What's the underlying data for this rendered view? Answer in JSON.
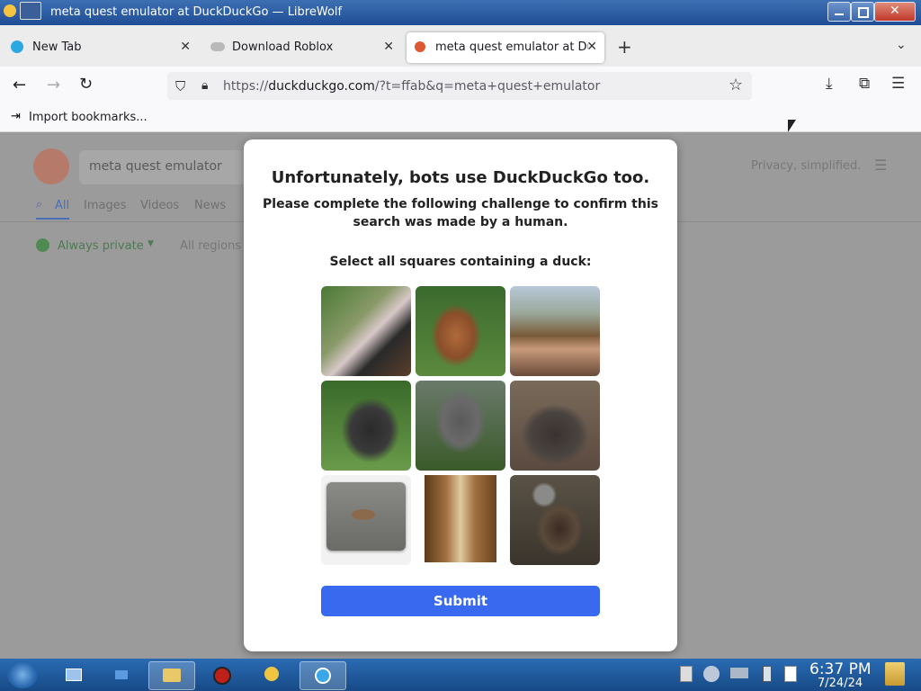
{
  "window": {
    "title": "meta quest emulator at DuckDuckGo — LibreWolf"
  },
  "tabs": [
    {
      "label": "New Tab",
      "icon": "librewolf-icon"
    },
    {
      "label": "Download Roblox",
      "icon": "cloud-icon"
    },
    {
      "label": "meta quest emulator at Du",
      "icon": "duckduckgo-icon",
      "active": true
    }
  ],
  "navbar": {
    "url_prefix": "https://",
    "url_domain": "duckduckgo.com",
    "url_path": "/?t=ffab&q=meta+quest+emulator"
  },
  "bookmarks": {
    "import_label": "Import bookmarks..."
  },
  "ddg": {
    "search_value": "meta quest emulator",
    "privacy_label": "Privacy, simplified.",
    "tabs": [
      "All",
      "Images",
      "Videos",
      "News"
    ],
    "always_private": "Always private",
    "regions": "All regions"
  },
  "captcha": {
    "title": "Unfortunately, bots use DuckDuckGo too.",
    "subtitle_line1": "Please complete the following challenge to confirm this",
    "subtitle_line2": "search was made by a human.",
    "instruction": "Select all squares containing a duck:",
    "tiles": [
      "panda",
      "duck",
      "dogs",
      "gorilla",
      "monkey",
      "buffalo",
      "duck on water",
      "giraffes",
      "duck"
    ],
    "submit_label": "Submit"
  },
  "taskbar": {
    "time": "6:37 PM",
    "date": "7/24/24"
  },
  "colors": {
    "accent": "#3969ef",
    "ddg_orange": "#de5833"
  }
}
